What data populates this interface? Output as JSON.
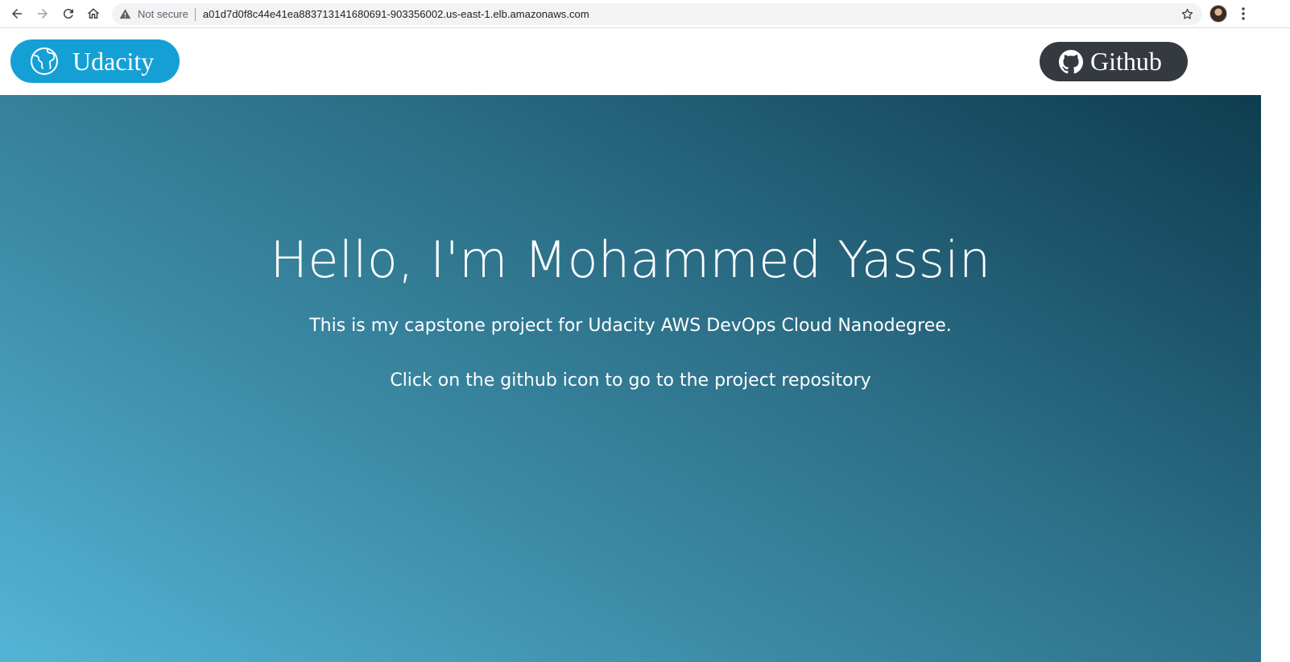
{
  "browser": {
    "security_label": "Not secure",
    "url": "a01d7d0f8c44e41ea883713141680691-903356002.us-east-1.elb.amazonaws.com",
    "icons": [
      "back-icon",
      "forward-icon",
      "reload-icon",
      "home-icon",
      "warning-icon",
      "star-icon",
      "avatar",
      "menu-kebab-icon"
    ]
  },
  "header": {
    "udacity_label": "Udacity",
    "github_label": "Github",
    "colors": {
      "udacity_bg": "#15a0d5",
      "github_bg": "#343a40"
    }
  },
  "hero": {
    "title": "Hello, I'm Mohammed Yassin",
    "subtitle": "This is my capstone project for Udacity AWS DevOps Cloud Nanodegree.",
    "instruction": "Click on the github icon to go to the project repository",
    "colors": {
      "gradient_start": "#55b4d6",
      "gradient_end": "#0e3d4f"
    }
  }
}
